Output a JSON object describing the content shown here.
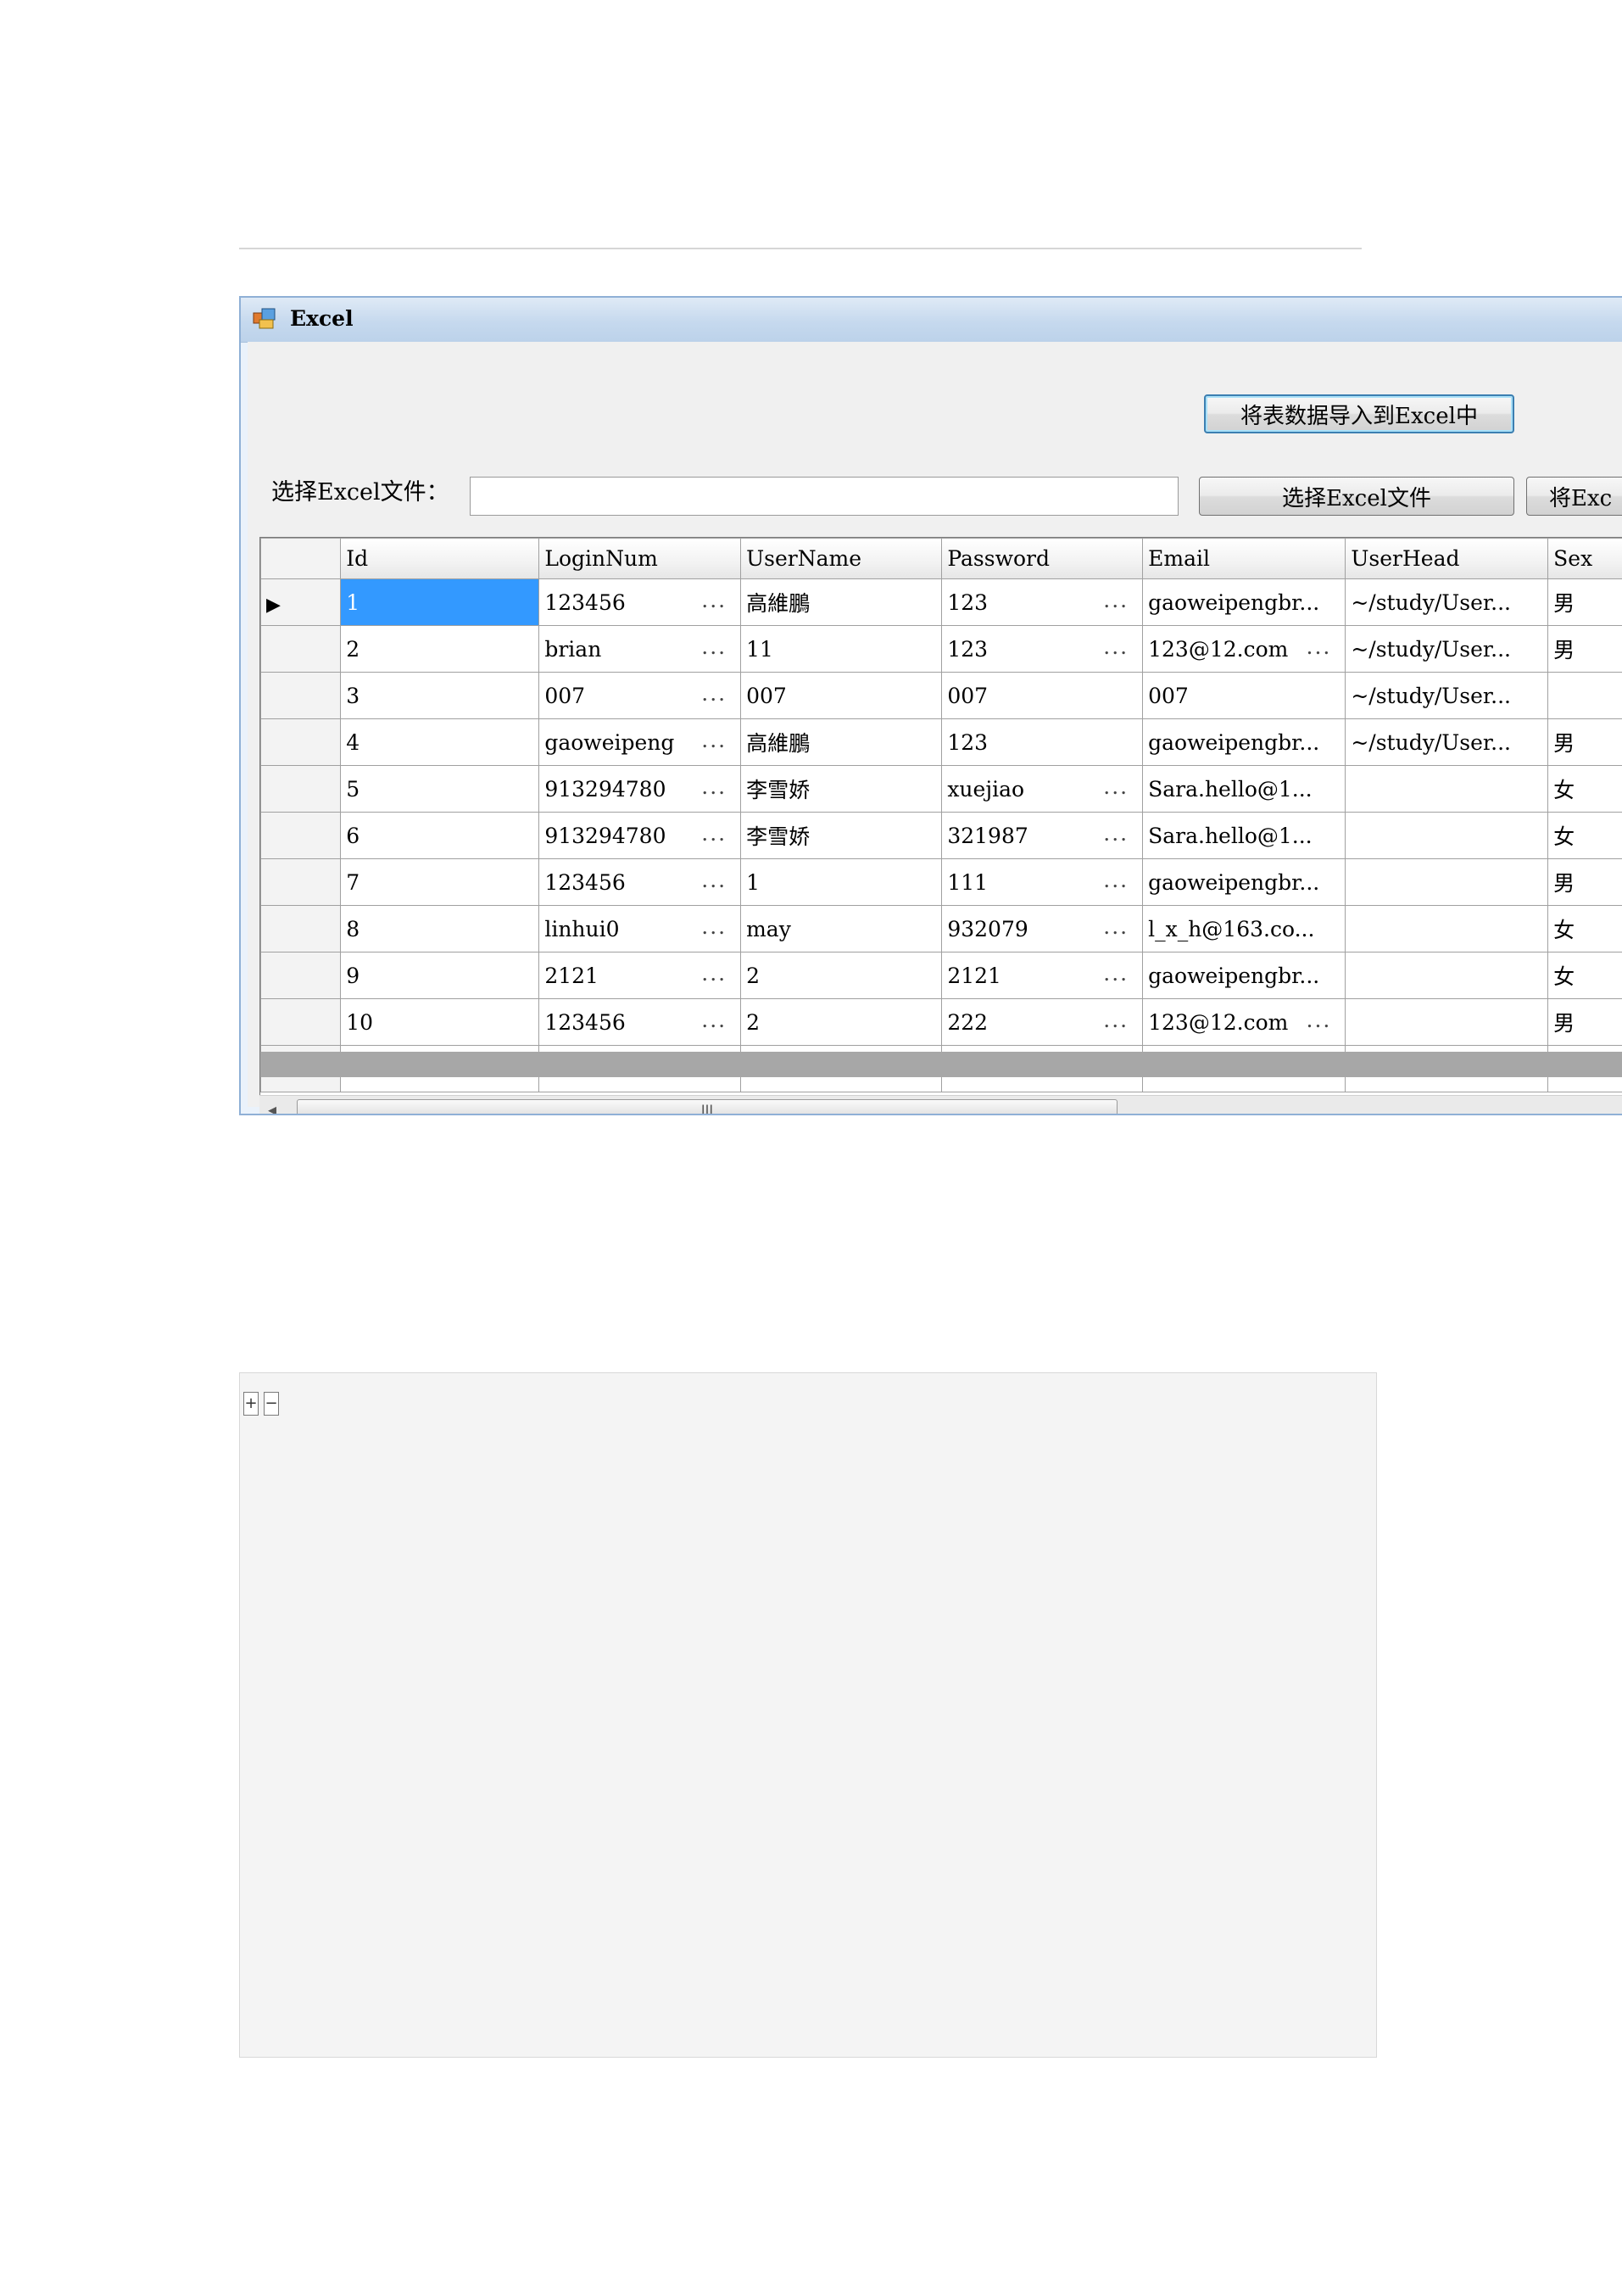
{
  "window": {
    "title": "Excel"
  },
  "toolbar": {
    "export_button": "将表数据导入到Excel中",
    "file_label": "选择Excel文件：",
    "file_value": "",
    "select_button": "选择Excel文件",
    "import_button_partial": "将Exc"
  },
  "grid": {
    "columns": [
      "Id",
      "LoginNum",
      "UserName",
      "Password",
      "Email",
      "UserHead",
      "Sex"
    ],
    "rows": [
      [
        "1",
        "123456",
        "高維鵬",
        "123",
        "gaoweipengbr...",
        "~/study/User...",
        "男"
      ],
      [
        "2",
        "brian",
        "11",
        "123",
        "123@12.com",
        "~/study/User...",
        "男"
      ],
      [
        "3",
        "007",
        "007",
        "007",
        "007",
        "~/study/User...",
        ""
      ],
      [
        "4",
        "gaoweipeng",
        "高維鵬",
        "123",
        "gaoweipengbr...",
        "~/study/User...",
        "男"
      ],
      [
        "5",
        "913294780",
        "李雪娇",
        "xuejiao",
        "Sara.hello@1...",
        "",
        "女"
      ],
      [
        "6",
        "913294780",
        "李雪娇",
        "321987",
        "Sara.hello@1...",
        "",
        "女"
      ],
      [
        "7",
        "123456",
        "1",
        "111",
        "gaoweipengbr...",
        "",
        "男"
      ],
      [
        "8",
        "linhui0",
        "may",
        "932079",
        "l_x_h@163.co...",
        "",
        "女"
      ],
      [
        "9",
        "2121",
        "2",
        "2121",
        "gaoweipengbr...",
        "",
        "女"
      ],
      [
        "10",
        "123456",
        "2",
        "222",
        "123@12.com",
        "",
        "男"
      ]
    ],
    "current_row_marker": "▶",
    "new_row_marker": "✳",
    "ellipsis": "...",
    "ellipsis_rows": {
      "LoginNum": [
        true,
        true,
        true,
        true,
        true,
        true,
        true,
        true,
        true,
        true
      ],
      "Password": [
        true,
        true,
        false,
        false,
        true,
        true,
        true,
        true,
        true,
        true
      ],
      "Email": [
        false,
        true,
        false,
        false,
        false,
        false,
        false,
        false,
        false,
        true
      ]
    }
  },
  "scrollbar": {
    "left_arrow": "◂",
    "thumb_grip": "III"
  },
  "panel": {
    "expand_label": "+",
    "collapse_label": "−"
  }
}
